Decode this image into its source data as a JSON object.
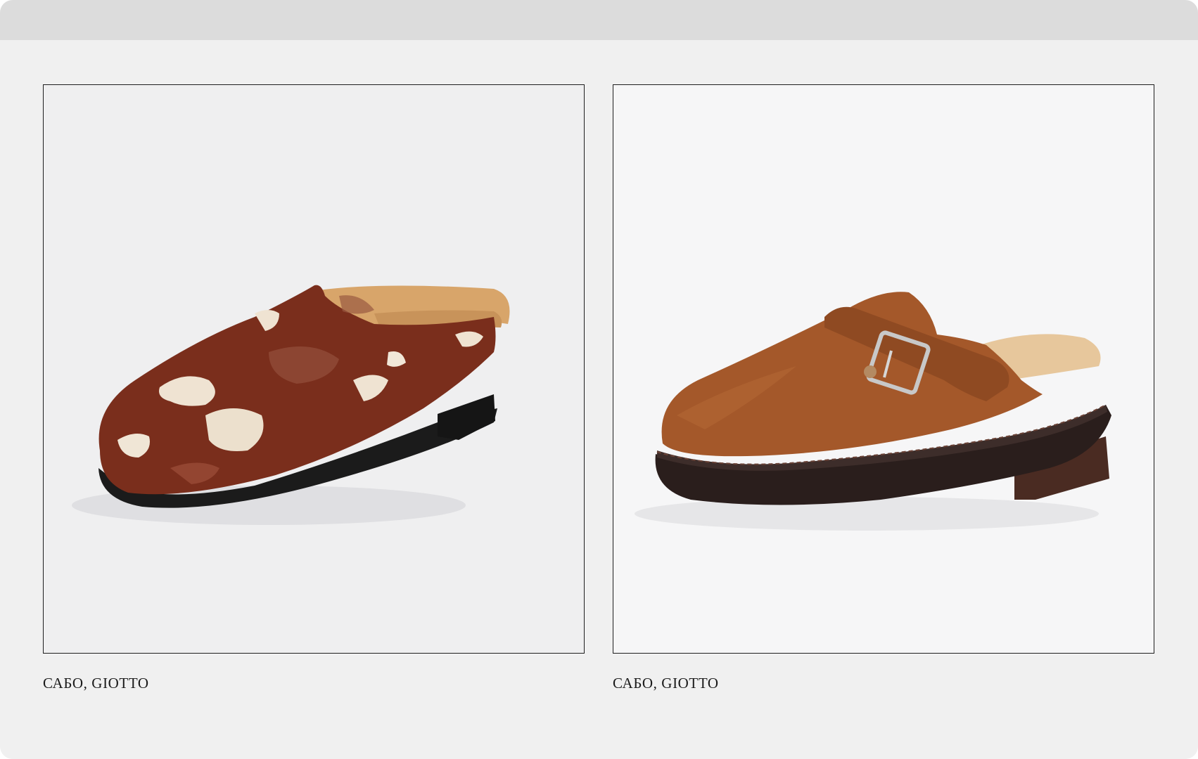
{
  "products": [
    {
      "caption": "САБО, GIOTTO",
      "image": "cowhide-print-mule",
      "colors": {
        "base": "#7a2e1c",
        "patch": "#efe3d2",
        "lining": "#d8a56a",
        "sole": "#1b1b1b"
      }
    },
    {
      "caption": "САБО, GIOTTO",
      "image": "suede-buckle-mule",
      "colors": {
        "base": "#a4582a",
        "strap": "#8f4a22",
        "buckle": "#c8c8c8",
        "sole": "#2a1e1c",
        "heel": "#4a2b22"
      }
    }
  ]
}
